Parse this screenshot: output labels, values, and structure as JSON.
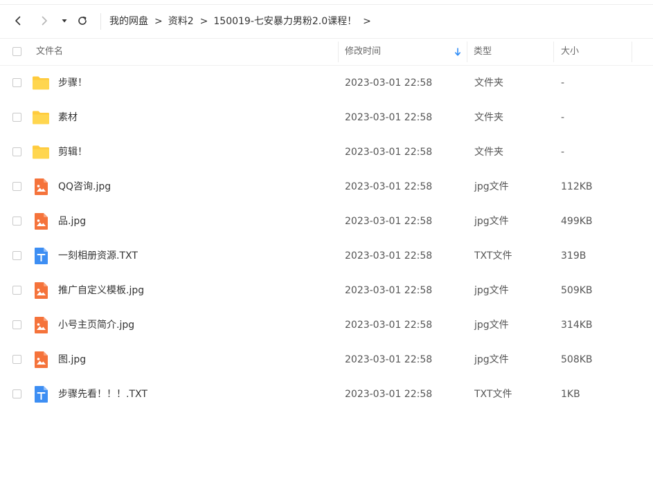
{
  "nav": {
    "back_icon": "chevron-left-icon",
    "forward_icon": "chevron-right-icon",
    "history_icon": "caret-down-icon",
    "refresh_icon": "refresh-icon"
  },
  "breadcrumb": {
    "items": [
      "我的网盘",
      "资料2",
      "150019-七安暴力男粉2.0课程！"
    ],
    "separator": ">"
  },
  "table": {
    "columns": {
      "name": "文件名",
      "modified": "修改时间",
      "type": "类型",
      "size": "大小"
    },
    "sort_icon": "sort-down-arrow-icon",
    "accent_color": "#2f8cf6",
    "rows": [
      {
        "icon": "folder-icon",
        "name": "步骤！",
        "modified": "2023-03-01 22:58",
        "type": "文件夹",
        "size": "-"
      },
      {
        "icon": "folder-icon",
        "name": "素材",
        "modified": "2023-03-01 22:58",
        "type": "文件夹",
        "size": "-"
      },
      {
        "icon": "folder-icon",
        "name": "剪辑！",
        "modified": "2023-03-01 22:58",
        "type": "文件夹",
        "size": "-"
      },
      {
        "icon": "image-file-icon",
        "name": "QQ咨询.jpg",
        "modified": "2023-03-01 22:58",
        "type": "jpg文件",
        "size": "112KB"
      },
      {
        "icon": "image-file-icon",
        "name": "品.jpg",
        "modified": "2023-03-01 22:58",
        "type": "jpg文件",
        "size": "499KB"
      },
      {
        "icon": "text-file-icon",
        "name": "一刻相册资源.TXT",
        "modified": "2023-03-01 22:58",
        "type": "TXT文件",
        "size": "319B"
      },
      {
        "icon": "image-file-icon",
        "name": "推广自定义模板.jpg",
        "modified": "2023-03-01 22:58",
        "type": "jpg文件",
        "size": "509KB"
      },
      {
        "icon": "image-file-icon",
        "name": "小号主页简介.jpg",
        "modified": "2023-03-01 22:58",
        "type": "jpg文件",
        "size": "314KB"
      },
      {
        "icon": "image-file-icon",
        "name": "图.jpg",
        "modified": "2023-03-01 22:58",
        "type": "jpg文件",
        "size": "508KB"
      },
      {
        "icon": "text-file-icon",
        "name": "步骤先看！！！.TXT",
        "modified": "2023-03-01 22:58",
        "type": "TXT文件",
        "size": "1KB"
      }
    ]
  },
  "colors": {
    "folder": "#ffcb3d",
    "image_file": "#f5733b",
    "text_file": "#3d8ef3"
  }
}
